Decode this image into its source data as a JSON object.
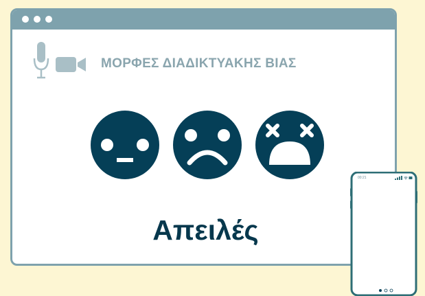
{
  "window": {
    "title": "ΜΟΡΦΕΣ ΔΙΑΔΙΚΤΥΑΚΗΣ ΒΙΑΣ",
    "caption": "Απειλές",
    "icons": [
      "microphone-icon",
      "video-camera-icon"
    ],
    "faces": [
      "neutral-face-icon",
      "sad-face-icon",
      "dizzy-face-icon"
    ]
  },
  "phone": {
    "time": "00:21",
    "status_icons": [
      "signal-icon",
      "wifi-icon",
      "battery-icon"
    ],
    "page_indicator": {
      "pages": 3,
      "active": 1
    }
  },
  "colors": {
    "background": "#fdf6d3",
    "frame": "#7ea2ad",
    "face": "#053f57",
    "caption": "#07384d",
    "title": "#8aa5ae"
  }
}
